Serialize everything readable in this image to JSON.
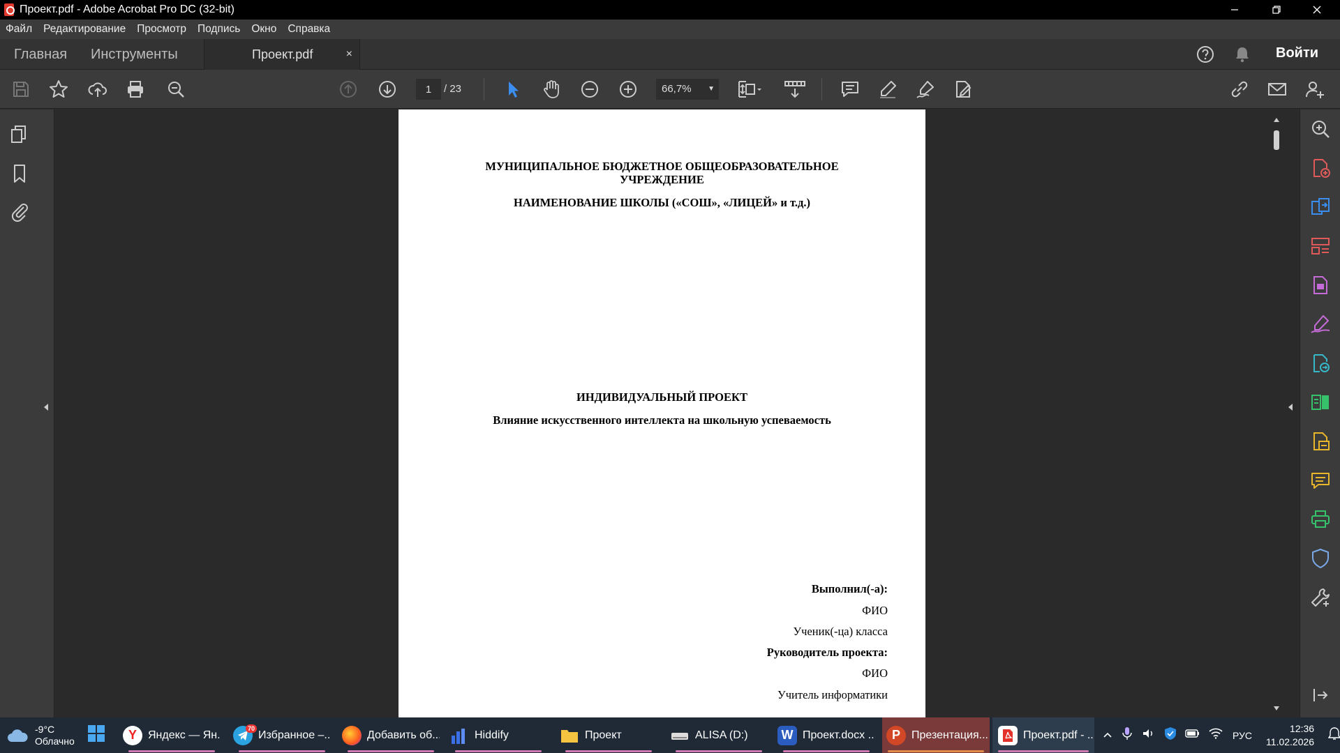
{
  "window": {
    "title": "Проект.pdf - Adobe Acrobat Pro DC (32-bit)",
    "controls": [
      "minimize",
      "restore",
      "close"
    ]
  },
  "menu": [
    "Файл",
    "Редактирование",
    "Просмотр",
    "Подпись",
    "Окно",
    "Справка"
  ],
  "tabs": {
    "home": "Главная",
    "tools": "Инструменты",
    "document": "Проект.pdf",
    "close": "×"
  },
  "header_right": {
    "signin": "Войти"
  },
  "toolbar": {
    "page_current": "1",
    "page_total": "/ 23",
    "zoom": "66,7%"
  },
  "document": {
    "line1": "МУНИЦИПАЛЬНОЕ БЮДЖЕТНОЕ ОБЩЕОБРАЗОВАТЕЛЬНОЕ",
    "line2": "УЧРЕЖДЕНИЕ",
    "line3": "НАИМЕНОВАНИЕ ШКОЛЫ («СОШ», «ЛИЦЕЙ» и т.д.)",
    "project_type": "ИНДИВИДУАЛЬНЫЙ ПРОЕКТ",
    "project_topic": "Влияние искусственного интеллекта на школьную успеваемость",
    "author_label": "Выполнил(-а):",
    "author_name": "ФИО",
    "author_role": "Ученик(-ца) класса",
    "supervisor_label": "Руководитель проекта:",
    "supervisor_name": "ФИО",
    "supervisor_role": "Учитель информатики"
  },
  "taskbar": {
    "weather_temp": "-9°C",
    "weather_desc": "Облачно",
    "items": [
      {
        "label": "Яндекс — Ян...",
        "icon": "yandex-browser-icon",
        "badge": ""
      },
      {
        "label": "Избранное –...",
        "icon": "telegram-icon",
        "badge": "70"
      },
      {
        "label": "Добавить об...",
        "icon": "firefox-icon",
        "badge": ""
      },
      {
        "label": "Hiddify",
        "icon": "hiddify-icon",
        "badge": ""
      },
      {
        "label": "Проект",
        "icon": "folder-icon",
        "badge": ""
      },
      {
        "label": "ALISA (D:)",
        "icon": "drive-icon",
        "badge": ""
      },
      {
        "label": "Проект.docx ...",
        "icon": "word-icon",
        "badge": ""
      },
      {
        "label": "Презентация...",
        "icon": "powerpoint-icon",
        "badge": ""
      },
      {
        "label": "Проект.pdf - ...",
        "icon": "acrobat-icon",
        "badge": ""
      }
    ],
    "lang": "РУС",
    "time": "12:36",
    "date": "11.02.2026"
  },
  "colors": {
    "accent_blue": "#3b8ef0",
    "purple_tools": "#c46bd8",
    "green_tools": "#36c26a",
    "taskbar_bg": "#1f2a36"
  }
}
